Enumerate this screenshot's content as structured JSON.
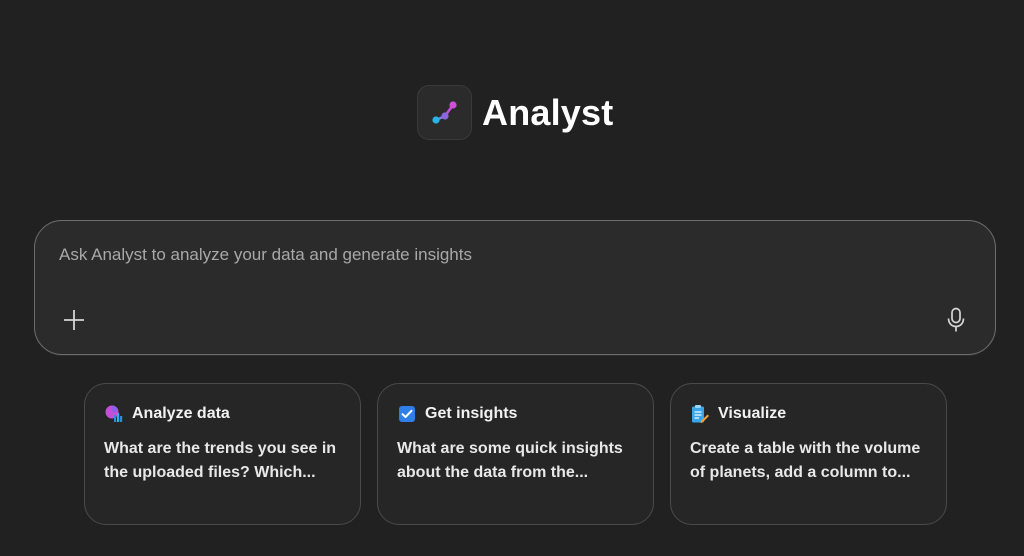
{
  "app": {
    "title": "Analyst",
    "logo_icon": "analyst-logo-icon"
  },
  "composer": {
    "placeholder": "Ask Analyst to analyze your data and generate insights",
    "value": "",
    "attach_icon": "plus-icon",
    "mic_icon": "microphone-icon"
  },
  "suggestions": [
    {
      "icon": "analyze-data-icon",
      "title": "Analyze data",
      "text_line1": "What are the trends you see in",
      "text_line2": "the uploaded files? Which..."
    },
    {
      "icon": "checkbox-icon",
      "title": "Get insights",
      "text_line1": "What are some quick insights",
      "text_line2": "about the data from the..."
    },
    {
      "icon": "visualize-icon",
      "title": "Visualize",
      "text_line1": "Create a table with the volume",
      "text_line2": "of planets, add a column to..."
    }
  ],
  "colors": {
    "background": "#212121",
    "card_background": "#262626",
    "composer_border": "#6e6e6e",
    "accent_pink": "#d14fd6",
    "accent_cyan": "#2ab3e6",
    "checkbox_blue": "#2f7fe8"
  }
}
